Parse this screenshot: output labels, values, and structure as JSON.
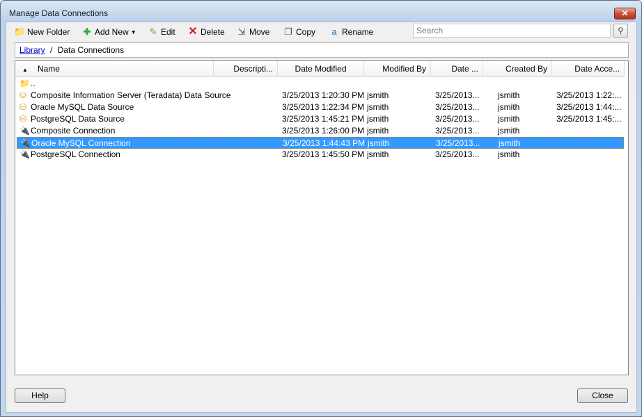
{
  "window": {
    "title": "Manage Data Connections",
    "close_icon": "close-icon"
  },
  "toolbar": {
    "new_folder": "New Folder",
    "add_new": "Add New",
    "edit": "Edit",
    "delete": "Delete",
    "move": "Move",
    "copy": "Copy",
    "rename": "Rename",
    "search_placeholder": "Search"
  },
  "breadcrumb": {
    "root": "Library",
    "separator": "/",
    "current": "Data Connections"
  },
  "columns": [
    "Name",
    "Descripti...",
    "Date Modified",
    "Modified By",
    "Date ...",
    "Created By",
    "Date Acce..."
  ],
  "rows": [
    {
      "icon": "folder",
      "name": "..",
      "description": "",
      "date_modified": "",
      "modified_by": "",
      "date": "",
      "created_by": "",
      "date_accessed": ""
    },
    {
      "icon": "database",
      "name": "Composite Information Server (Teradata) Data Source",
      "description": "",
      "date_modified": "3/25/2013 1:20:30 PM",
      "modified_by": "jsmith",
      "date": "3/25/2013...",
      "created_by": "jsmith",
      "date_accessed": "3/25/2013 1:22:..."
    },
    {
      "icon": "database",
      "name": "Oracle MySQL Data Source",
      "description": "",
      "date_modified": "3/25/2013 1:22:34 PM",
      "modified_by": "jsmith",
      "date": "3/25/2013...",
      "created_by": "jsmith",
      "date_accessed": "3/25/2013 1:44:..."
    },
    {
      "icon": "database",
      "name": "PostgreSQL Data Source",
      "description": "",
      "date_modified": "3/25/2013 1:45:21 PM",
      "modified_by": "jsmith",
      "date": "3/25/2013...",
      "created_by": "jsmith",
      "date_accessed": "3/25/2013 1:45:..."
    },
    {
      "icon": "plug",
      "name": "Composite Connection",
      "description": "",
      "date_modified": "3/25/2013 1:26:00 PM",
      "modified_by": "jsmith",
      "date": "3/25/2013...",
      "created_by": "jsmith",
      "date_accessed": ""
    },
    {
      "icon": "plug",
      "name": "Oracle MySQL Connection",
      "description": "",
      "date_modified": "3/25/2013 1:44:43 PM",
      "modified_by": "jsmith",
      "date": "3/25/2013...",
      "created_by": "jsmith",
      "date_accessed": "",
      "selected": true
    },
    {
      "icon": "plug",
      "name": "PostgreSQL Connection",
      "description": "",
      "date_modified": "3/25/2013 1:45:50 PM",
      "modified_by": "jsmith",
      "date": "3/25/2013...",
      "created_by": "jsmith",
      "date_accessed": ""
    }
  ],
  "footer": {
    "help": "Help",
    "close": "Close"
  },
  "colors": {
    "selection": "#3399ff",
    "link": "#0000cc"
  }
}
